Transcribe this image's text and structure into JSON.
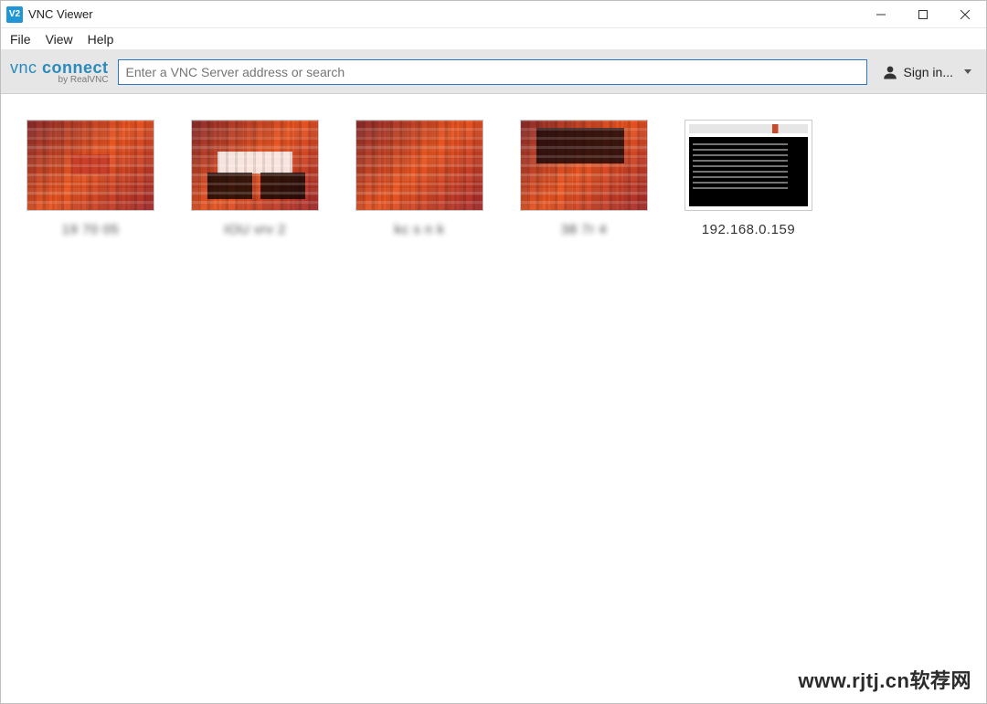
{
  "window": {
    "title": "VNC Viewer",
    "icon_text": "V2"
  },
  "menu": {
    "items": [
      "File",
      "View",
      "Help"
    ]
  },
  "toolbar": {
    "logo_main_vnc": "vnc",
    "logo_main_connect": "connect",
    "logo_sub": "by RealVNC",
    "search_placeholder": "Enter a VNC Server address or search",
    "signin_label": "Sign in..."
  },
  "connections": [
    {
      "label": "19 70 05",
      "type": "ubuntu",
      "overlay": "badge",
      "label_clear": false
    },
    {
      "label": "IOU vrv 2",
      "type": "ubuntu",
      "overlay": "windows",
      "label_clear": false
    },
    {
      "label": "kc s n k",
      "type": "ubuntu",
      "overlay": "plain",
      "label_clear": false
    },
    {
      "label": "38 7r 4",
      "type": "ubuntu",
      "overlay": "term",
      "label_clear": false
    },
    {
      "label": "192.168.0.159",
      "type": "terminal",
      "overlay": "",
      "label_clear": true
    }
  ],
  "watermark": "www.rjtj.cn软荐网"
}
